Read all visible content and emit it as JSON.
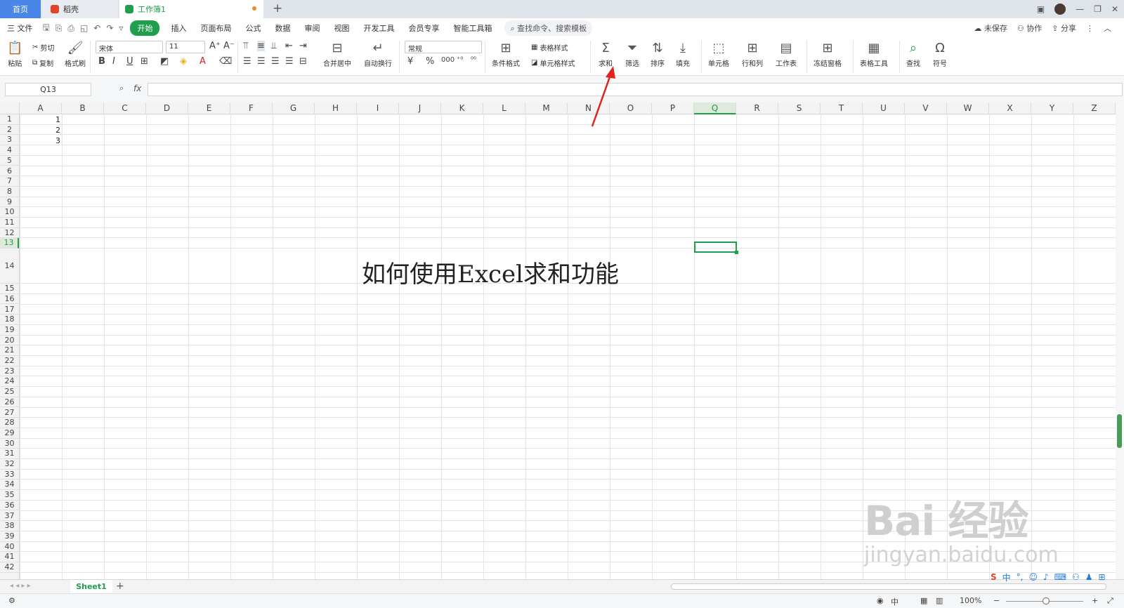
{
  "titlebar": {
    "tab_home": "首页",
    "tab_doc": "稻壳",
    "tab_book": "工作簿1",
    "add_tab": "+"
  },
  "menubar": {
    "file": "三 文件",
    "items": [
      "开始",
      "插入",
      "页面布局",
      "公式",
      "数据",
      "审阅",
      "视图",
      "开发工具",
      "会员专享",
      "智能工具箱"
    ],
    "search": "查找命令、搜索模板",
    "unsaved": "未保存",
    "collab": "协作",
    "share": "分享"
  },
  "ribbon": {
    "paste": "粘贴",
    "cut": "剪切",
    "copy": "复制",
    "format_painter": "格式刷",
    "font_name": "宋体",
    "font_size": "11",
    "merge_center": "合并居中",
    "wrap_text": "自动换行",
    "number_format": "常规",
    "conditional_format": "条件格式",
    "table_style": "表格样式",
    "cell_style": "单元格样式",
    "sum": "求和",
    "filter": "筛选",
    "sort": "排序",
    "fill": "填充",
    "cells": "单元格",
    "row_col": "行和列",
    "worksheet": "工作表",
    "freeze": "冻结窗格",
    "table_tools": "表格工具",
    "find": "查找",
    "symbol": "符号"
  },
  "formula_bar": {
    "name_box": "Q13",
    "fx": "fx",
    "content": ""
  },
  "columns": [
    "A",
    "B",
    "C",
    "D",
    "E",
    "F",
    "G",
    "H",
    "I",
    "J",
    "K",
    "L",
    "M",
    "N",
    "O",
    "P",
    "Q",
    "R",
    "S",
    "T",
    "U",
    "V",
    "W",
    "X",
    "Y",
    "Z"
  ],
  "active_column": "Q",
  "active_row": "13",
  "cells": {
    "A1": "1",
    "A2": "2",
    "A3": "3"
  },
  "overlay_text": "如何使用Excel求和功能",
  "sheet": {
    "tab": "Sheet1",
    "add": "+"
  },
  "status": {
    "zoom": "100%",
    "ime": "中"
  },
  "watermark": {
    "line1": "Bai 经验",
    "line2": "jingyan.baidu.com"
  },
  "colors": {
    "accent_green": "#1f9e4b",
    "home_tab_blue": "#4a86e8",
    "arrow_red": "#e0251b"
  }
}
